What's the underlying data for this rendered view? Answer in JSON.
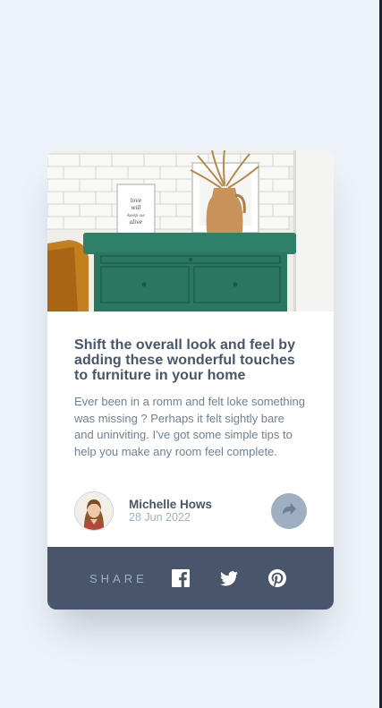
{
  "article": {
    "title": "Shift the overall look and feel by adding these wonderful touches to furniture in your home",
    "excerpt": "Ever been in a romm and felt loke something was missing ? Perhaps it felt sightly bare and uninviting. I've got some simple tips to help you make any room feel complete."
  },
  "author": {
    "name": "Michelle Hows",
    "date": "28 Jun 2022"
  },
  "share": {
    "label": "SHARE",
    "networks": [
      "facebook-icon",
      "twitter-icon",
      "pinterest-icon"
    ]
  },
  "colors": {
    "page_bg": "#ECF2F8",
    "card_bg": "#FFFFFF",
    "heading": "#48556A",
    "body_text": "#6E8098",
    "muted": "#9EAFC2",
    "share_bar": "#48556A"
  }
}
